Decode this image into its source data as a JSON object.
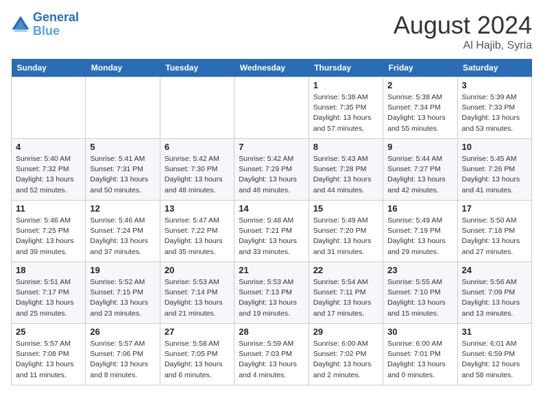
{
  "header": {
    "logo_general": "General",
    "logo_blue": "Blue",
    "month_year": "August 2024",
    "location": "Al Hajib, Syria"
  },
  "weekdays": [
    "Sunday",
    "Monday",
    "Tuesday",
    "Wednesday",
    "Thursday",
    "Friday",
    "Saturday"
  ],
  "weeks": [
    [
      {
        "day": "",
        "sunrise": "",
        "sunset": "",
        "daylight": ""
      },
      {
        "day": "",
        "sunrise": "",
        "sunset": "",
        "daylight": ""
      },
      {
        "day": "",
        "sunrise": "",
        "sunset": "",
        "daylight": ""
      },
      {
        "day": "",
        "sunrise": "",
        "sunset": "",
        "daylight": ""
      },
      {
        "day": "1",
        "sunrise": "Sunrise: 5:38 AM",
        "sunset": "Sunset: 7:35 PM",
        "daylight": "Daylight: 13 hours and 57 minutes."
      },
      {
        "day": "2",
        "sunrise": "Sunrise: 5:38 AM",
        "sunset": "Sunset: 7:34 PM",
        "daylight": "Daylight: 13 hours and 55 minutes."
      },
      {
        "day": "3",
        "sunrise": "Sunrise: 5:39 AM",
        "sunset": "Sunset: 7:33 PM",
        "daylight": "Daylight: 13 hours and 53 minutes."
      }
    ],
    [
      {
        "day": "4",
        "sunrise": "Sunrise: 5:40 AM",
        "sunset": "Sunset: 7:32 PM",
        "daylight": "Daylight: 13 hours and 52 minutes."
      },
      {
        "day": "5",
        "sunrise": "Sunrise: 5:41 AM",
        "sunset": "Sunset: 7:31 PM",
        "daylight": "Daylight: 13 hours and 50 minutes."
      },
      {
        "day": "6",
        "sunrise": "Sunrise: 5:42 AM",
        "sunset": "Sunset: 7:30 PM",
        "daylight": "Daylight: 13 hours and 48 minutes."
      },
      {
        "day": "7",
        "sunrise": "Sunrise: 5:42 AM",
        "sunset": "Sunset: 7:29 PM",
        "daylight": "Daylight: 13 hours and 46 minutes."
      },
      {
        "day": "8",
        "sunrise": "Sunrise: 5:43 AM",
        "sunset": "Sunset: 7:28 PM",
        "daylight": "Daylight: 13 hours and 44 minutes."
      },
      {
        "day": "9",
        "sunrise": "Sunrise: 5:44 AM",
        "sunset": "Sunset: 7:27 PM",
        "daylight": "Daylight: 13 hours and 42 minutes."
      },
      {
        "day": "10",
        "sunrise": "Sunrise: 5:45 AM",
        "sunset": "Sunset: 7:26 PM",
        "daylight": "Daylight: 13 hours and 41 minutes."
      }
    ],
    [
      {
        "day": "11",
        "sunrise": "Sunrise: 5:46 AM",
        "sunset": "Sunset: 7:25 PM",
        "daylight": "Daylight: 13 hours and 39 minutes."
      },
      {
        "day": "12",
        "sunrise": "Sunrise: 5:46 AM",
        "sunset": "Sunset: 7:24 PM",
        "daylight": "Daylight: 13 hours and 37 minutes."
      },
      {
        "day": "13",
        "sunrise": "Sunrise: 5:47 AM",
        "sunset": "Sunset: 7:22 PM",
        "daylight": "Daylight: 13 hours and 35 minutes."
      },
      {
        "day": "14",
        "sunrise": "Sunrise: 5:48 AM",
        "sunset": "Sunset: 7:21 PM",
        "daylight": "Daylight: 13 hours and 33 minutes."
      },
      {
        "day": "15",
        "sunrise": "Sunrise: 5:49 AM",
        "sunset": "Sunset: 7:20 PM",
        "daylight": "Daylight: 13 hours and 31 minutes."
      },
      {
        "day": "16",
        "sunrise": "Sunrise: 5:49 AM",
        "sunset": "Sunset: 7:19 PM",
        "daylight": "Daylight: 13 hours and 29 minutes."
      },
      {
        "day": "17",
        "sunrise": "Sunrise: 5:50 AM",
        "sunset": "Sunset: 7:18 PM",
        "daylight": "Daylight: 13 hours and 27 minutes."
      }
    ],
    [
      {
        "day": "18",
        "sunrise": "Sunrise: 5:51 AM",
        "sunset": "Sunset: 7:17 PM",
        "daylight": "Daylight: 13 hours and 25 minutes."
      },
      {
        "day": "19",
        "sunrise": "Sunrise: 5:52 AM",
        "sunset": "Sunset: 7:15 PM",
        "daylight": "Daylight: 13 hours and 23 minutes."
      },
      {
        "day": "20",
        "sunrise": "Sunrise: 5:53 AM",
        "sunset": "Sunset: 7:14 PM",
        "daylight": "Daylight: 13 hours and 21 minutes."
      },
      {
        "day": "21",
        "sunrise": "Sunrise: 5:53 AM",
        "sunset": "Sunset: 7:13 PM",
        "daylight": "Daylight: 13 hours and 19 minutes."
      },
      {
        "day": "22",
        "sunrise": "Sunrise: 5:54 AM",
        "sunset": "Sunset: 7:11 PM",
        "daylight": "Daylight: 13 hours and 17 minutes."
      },
      {
        "day": "23",
        "sunrise": "Sunrise: 5:55 AM",
        "sunset": "Sunset: 7:10 PM",
        "daylight": "Daylight: 13 hours and 15 minutes."
      },
      {
        "day": "24",
        "sunrise": "Sunrise: 5:56 AM",
        "sunset": "Sunset: 7:09 PM",
        "daylight": "Daylight: 13 hours and 13 minutes."
      }
    ],
    [
      {
        "day": "25",
        "sunrise": "Sunrise: 5:57 AM",
        "sunset": "Sunset: 7:08 PM",
        "daylight": "Daylight: 13 hours and 11 minutes."
      },
      {
        "day": "26",
        "sunrise": "Sunrise: 5:57 AM",
        "sunset": "Sunset: 7:06 PM",
        "daylight": "Daylight: 13 hours and 8 minutes."
      },
      {
        "day": "27",
        "sunrise": "Sunrise: 5:58 AM",
        "sunset": "Sunset: 7:05 PM",
        "daylight": "Daylight: 13 hours and 6 minutes."
      },
      {
        "day": "28",
        "sunrise": "Sunrise: 5:59 AM",
        "sunset": "Sunset: 7:03 PM",
        "daylight": "Daylight: 13 hours and 4 minutes."
      },
      {
        "day": "29",
        "sunrise": "Sunrise: 6:00 AM",
        "sunset": "Sunset: 7:02 PM",
        "daylight": "Daylight: 13 hours and 2 minutes."
      },
      {
        "day": "30",
        "sunrise": "Sunrise: 6:00 AM",
        "sunset": "Sunset: 7:01 PM",
        "daylight": "Daylight: 13 hours and 0 minutes."
      },
      {
        "day": "31",
        "sunrise": "Sunrise: 6:01 AM",
        "sunset": "Sunset: 6:59 PM",
        "daylight": "Daylight: 12 hours and 58 minutes."
      }
    ]
  ]
}
